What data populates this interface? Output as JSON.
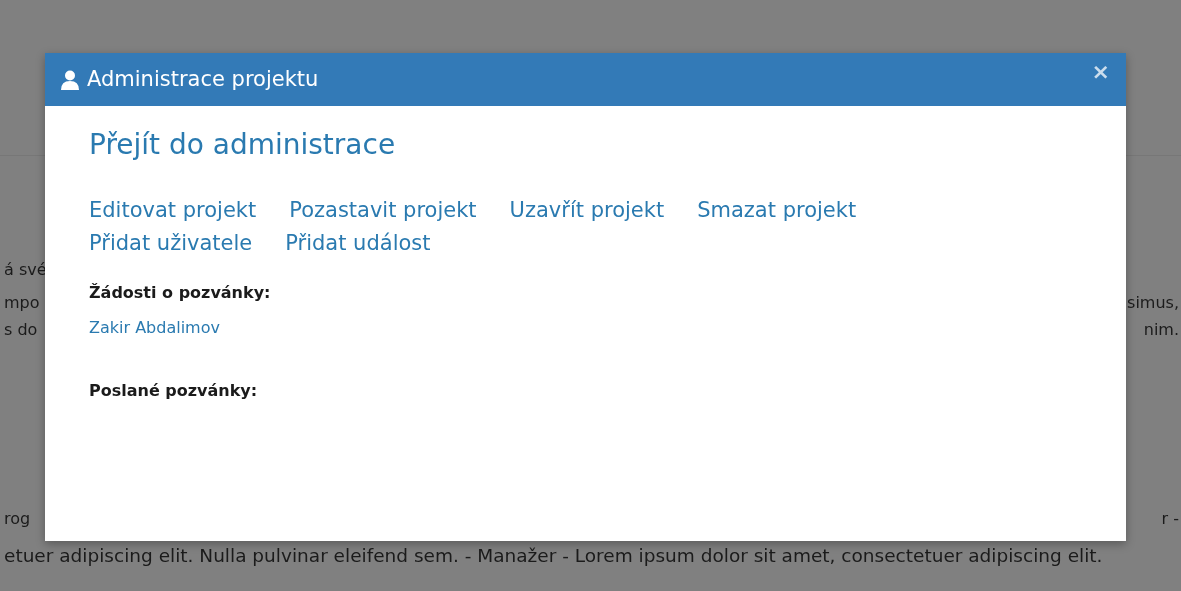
{
  "background": {
    "lines": [
      {
        "left": "á své"
      },
      {
        "left": "mpo",
        "right": "simus,"
      },
      {
        "left": "s do",
        "right": "nim."
      },
      {
        "left": "rog",
        "right": "r -"
      },
      {
        "left": "etuer adipiscing elit. Nulla pulvinar eleifend sem. - Manažer - Lorem ipsum dolor sit amet, consectetuer adipiscing elit."
      }
    ]
  },
  "modal": {
    "title": "Administrace projektu",
    "close": "×",
    "heading": "Přejít do administrace",
    "actions": [
      "Editovat projekt",
      "Pozastavit projekt",
      "Uzavřít projekt",
      "Smazat projekt",
      "Přidat uživatele",
      "Přidat událost"
    ],
    "sections": [
      {
        "label": "Žádosti o pozvánky:",
        "items": [
          "Zakir Abdalimov"
        ]
      },
      {
        "label": "Poslané pozvánky:"
      }
    ]
  }
}
